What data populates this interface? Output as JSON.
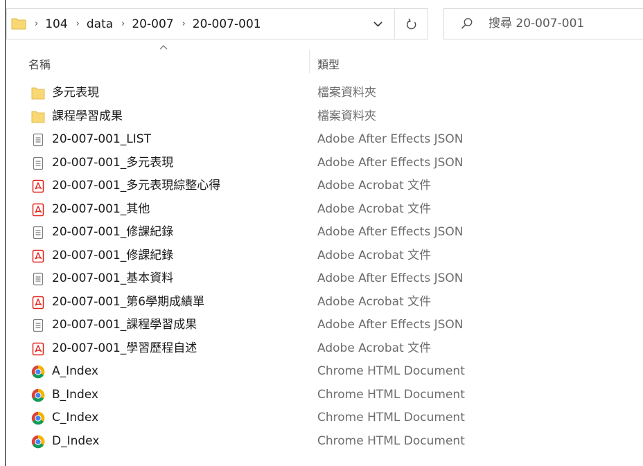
{
  "breadcrumb": [
    "104",
    "data",
    "20-007",
    "20-007-001"
  ],
  "search": {
    "placeholder": "搜尋 20-007-001"
  },
  "columns": {
    "name": "名稱",
    "type": "類型"
  },
  "files": [
    {
      "name": "多元表現",
      "type": "檔案資料夾",
      "icon": "folder-icon"
    },
    {
      "name": "課程學習成果",
      "type": "檔案資料夾",
      "icon": "folder-icon"
    },
    {
      "name": "20-007-001_LIST",
      "type": "Adobe After Effects JSON",
      "icon": "json-file-icon"
    },
    {
      "name": "20-007-001_多元表現",
      "type": "Adobe After Effects JSON",
      "icon": "json-file-icon"
    },
    {
      "name": "20-007-001_多元表現綜整心得",
      "type": "Adobe Acrobat 文件",
      "icon": "pdf-file-icon"
    },
    {
      "name": "20-007-001_其他",
      "type": "Adobe Acrobat 文件",
      "icon": "pdf-file-icon"
    },
    {
      "name": "20-007-001_修課紀錄",
      "type": "Adobe After Effects JSON",
      "icon": "json-file-icon"
    },
    {
      "name": "20-007-001_修課紀錄",
      "type": "Adobe Acrobat 文件",
      "icon": "pdf-file-icon"
    },
    {
      "name": "20-007-001_基本資料",
      "type": "Adobe After Effects JSON",
      "icon": "json-file-icon"
    },
    {
      "name": "20-007-001_第6學期成績單",
      "type": "Adobe Acrobat 文件",
      "icon": "pdf-file-icon"
    },
    {
      "name": "20-007-001_課程學習成果",
      "type": "Adobe After Effects JSON",
      "icon": "json-file-icon"
    },
    {
      "name": "20-007-001_學習歷程自述",
      "type": "Adobe Acrobat 文件",
      "icon": "pdf-file-icon"
    },
    {
      "name": "A_Index",
      "type": "Chrome HTML Document",
      "icon": "chrome-icon"
    },
    {
      "name": "B_Index",
      "type": "Chrome HTML Document",
      "icon": "chrome-icon"
    },
    {
      "name": "C_Index",
      "type": "Chrome HTML Document",
      "icon": "chrome-icon"
    },
    {
      "name": "D_Index",
      "type": "Chrome HTML Document",
      "icon": "chrome-icon"
    }
  ],
  "colors": {
    "folder": "#f8d775",
    "pdf": "#e2231a",
    "chrome_red": "#db4437",
    "chrome_yellow": "#f4b400",
    "chrome_green": "#0f9d58",
    "chrome_blue": "#4285f4"
  }
}
